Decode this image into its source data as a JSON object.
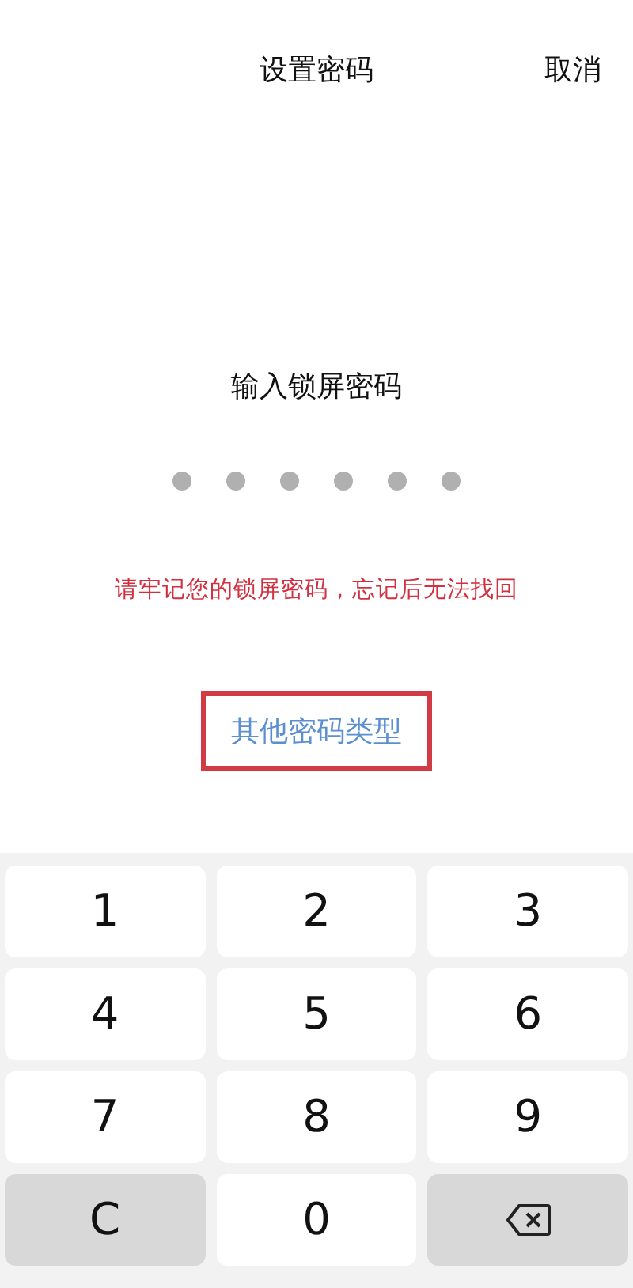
{
  "header": {
    "title": "设置密码",
    "cancel": "取消"
  },
  "prompt": "输入锁屏密码",
  "pin_dots": [
    {
      "filled": false
    },
    {
      "filled": false
    },
    {
      "filled": false
    },
    {
      "filled": false
    },
    {
      "filled": false
    },
    {
      "filled": false
    }
  ],
  "warning": "请牢记您的锁屏密码，忘记后无法找回",
  "other_types_link": {
    "label": "其他密码类型",
    "highlighted": true
  },
  "keypad": [
    {
      "kind": "digit",
      "label": "1"
    },
    {
      "kind": "digit",
      "label": "2"
    },
    {
      "kind": "digit",
      "label": "3"
    },
    {
      "kind": "digit",
      "label": "4"
    },
    {
      "kind": "digit",
      "label": "5"
    },
    {
      "kind": "digit",
      "label": "6"
    },
    {
      "kind": "digit",
      "label": "7"
    },
    {
      "kind": "digit",
      "label": "8"
    },
    {
      "kind": "digit",
      "label": "9"
    },
    {
      "kind": "clear",
      "label": "C"
    },
    {
      "kind": "digit",
      "label": "0"
    },
    {
      "kind": "backspace"
    }
  ]
}
